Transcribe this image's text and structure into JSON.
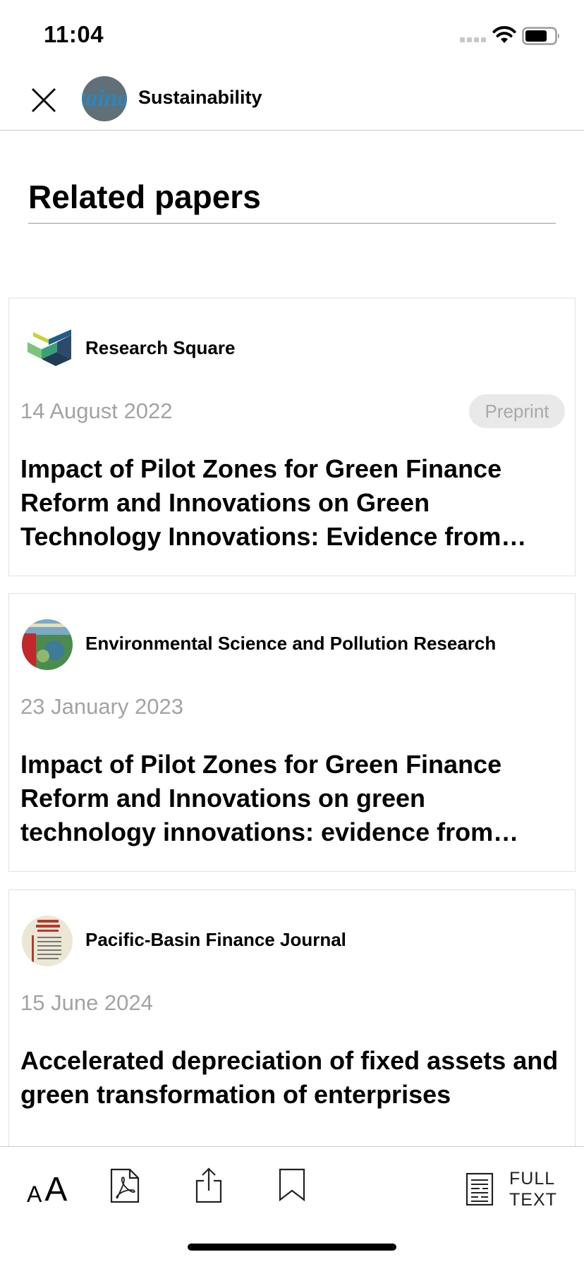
{
  "status_bar": {
    "time": "11:04"
  },
  "nav": {
    "journal_name": "Sustainability",
    "avatar_text": "taina"
  },
  "section": {
    "title": "Related papers"
  },
  "cards": [
    {
      "source": "Research Square",
      "date": "14 August 2022",
      "badge": "Preprint",
      "title": "Impact of Pilot Zones for Green Finance Reform and Innovations on Green Technology Innovations: Evidence from China"
    },
    {
      "source": "Environmental Science and Pollution Research",
      "date": "23 January 2023",
      "title": "Impact of Pilot Zones for Green Finance Reform and Innovations on green technology innovations: evidence from China"
    },
    {
      "source": "Pacific-Basin Finance Journal",
      "date": "15 June 2024",
      "title": "Accelerated depreciation of fixed assets and green transformation of enterprises"
    }
  ],
  "toolbar": {
    "font_small": "A",
    "font_large": "A",
    "fulltext_line1": "FULL",
    "fulltext_line2": "TEXT"
  },
  "icons": {
    "close": "close-icon",
    "pdf": "pdf-icon",
    "share": "share-icon",
    "bookmark": "bookmark-icon",
    "fulltext": "document-icon"
  },
  "colors": {
    "badge_bg": "#e9e9e9",
    "date_text": "#a3a3a3",
    "divider": "#c9c9c9"
  }
}
